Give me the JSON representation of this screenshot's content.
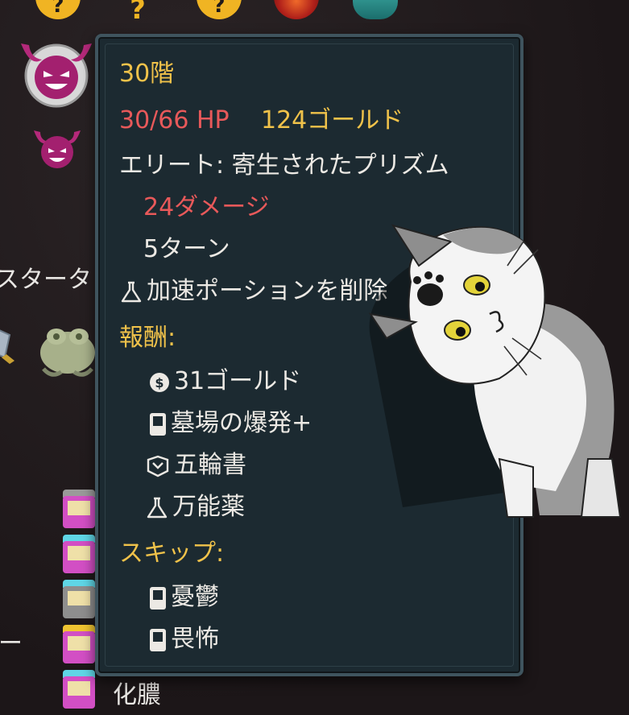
{
  "top_icons": [
    "question-icon",
    "question-icon",
    "question-icon",
    "fire-orb-icon",
    "teal-relic-icon"
  ],
  "side_labels": {
    "starter": "スタータ",
    "dash": "ー",
    "card_bottom": "化膿"
  },
  "tooltip": {
    "floor": "30階",
    "hp": "30/66 HP",
    "gold": "124ゴールド",
    "enemy": "エリート: 寄生されたプリズム",
    "damage": "24ダメージ",
    "turns": "5ターン",
    "potion_removed": "加速ポーションを削除",
    "rewards_header": "報酬:",
    "rewards": [
      {
        "icon": "coin-icon",
        "label": "31ゴールド"
      },
      {
        "icon": "card-icon",
        "label": "墓場の爆発+"
      },
      {
        "icon": "relic-icon",
        "label": "五輪書"
      },
      {
        "icon": "potion-icon",
        "label": "万能薬"
      }
    ],
    "skip_header": "スキップ:",
    "skipped": [
      {
        "icon": "card-icon",
        "label": "憂鬱"
      },
      {
        "icon": "card-icon",
        "label": "畏怖"
      }
    ]
  },
  "colors": {
    "gold": "#f0c24a",
    "red": "#e8595a",
    "tooltip_bg": "#1c2a31",
    "tooltip_border": "#3f545e"
  }
}
